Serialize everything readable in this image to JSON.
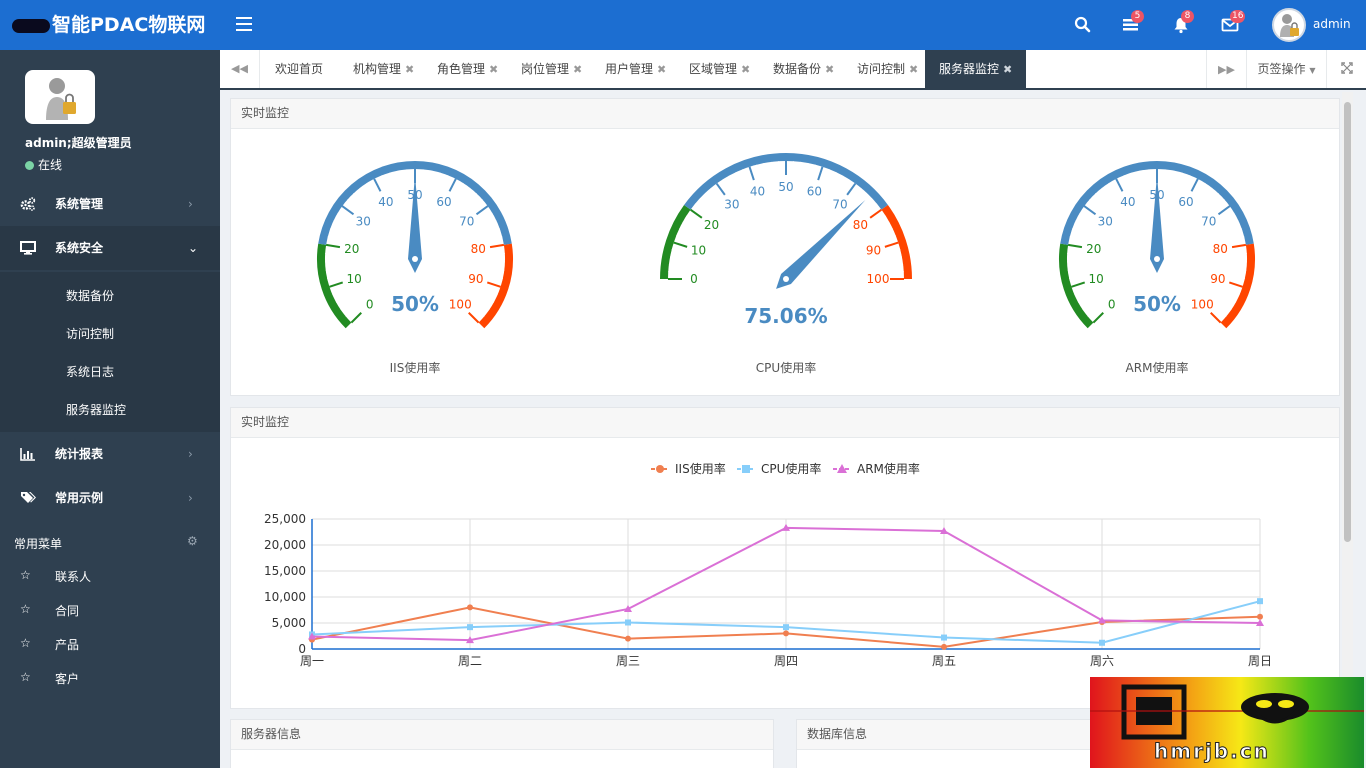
{
  "app": {
    "brand": "智能PDAC物联网",
    "user": "admin"
  },
  "header": {
    "badges": {
      "tasks": "5",
      "alerts": "8",
      "messages": "16"
    }
  },
  "sidebar": {
    "profile_name": "admin;超级管理员",
    "status": "在线",
    "menu": [
      {
        "label": "系统管理",
        "icon": "gears-icon"
      },
      {
        "label": "系统安全",
        "icon": "monitor-icon"
      },
      {
        "label": "统计报表",
        "icon": "bar-chart-icon"
      },
      {
        "label": "常用示例",
        "icon": "tags-icon"
      }
    ],
    "submenu": [
      "数据备份",
      "访问控制",
      "系统日志",
      "服务器监控"
    ],
    "section_title": "常用菜单",
    "favorites": [
      "联系人",
      "合同",
      "产品",
      "客户"
    ]
  },
  "tabs": {
    "items": [
      "欢迎首页",
      "机构管理",
      "角色管理",
      "岗位管理",
      "用户管理",
      "区域管理",
      "数据备份",
      "访问控制",
      "服务器监控"
    ],
    "active": "服务器监控",
    "tab_ops": "页签操作"
  },
  "panels": {
    "realtime1": "实时监控",
    "realtime2": "实时监控",
    "server_info": "服务器信息",
    "db_info": "数据库信息"
  },
  "gauges": [
    {
      "name": "IIS使用率",
      "value": 50,
      "display": "50%"
    },
    {
      "name": "CPU使用率",
      "value": 75.06,
      "display": "75.06%"
    },
    {
      "name": "ARM使用率",
      "value": 50,
      "display": "50%"
    }
  ],
  "gauge_ticks": [
    "0",
    "10",
    "20",
    "30",
    "40",
    "50",
    "60",
    "70",
    "80",
    "90",
    "100"
  ],
  "colors": {
    "header": "#1c6ed1",
    "sidebar": "#2f4050",
    "gauge_green": "#228b22",
    "gauge_blue": "#4a8bc2",
    "gauge_red": "#ff4500",
    "iis": "#f07f50",
    "cpu": "#87cefa",
    "arm": "#da70d6"
  },
  "chart_data": {
    "type": "line",
    "categories": [
      "周一",
      "周二",
      "周三",
      "周四",
      "周五",
      "周六",
      "周日"
    ],
    "series": [
      {
        "name": "IIS使用率",
        "values": [
          1800,
          8000,
          2000,
          3000,
          400,
          5200,
          6200
        ]
      },
      {
        "name": "CPU使用率",
        "values": [
          2800,
          4200,
          5100,
          4200,
          2200,
          1200,
          9200
        ]
      },
      {
        "name": "ARM使用率",
        "values": [
          2400,
          1700,
          7700,
          23300,
          22700,
          5500,
          5000
        ]
      }
    ],
    "ylim": [
      0,
      25000
    ],
    "yticks": [
      "0",
      "5,000",
      "10,000",
      "15,000",
      "20,000",
      "25,000"
    ],
    "legend": "top-center",
    "grid": true
  },
  "watermark": {
    "text": "hmrjb.cn"
  }
}
